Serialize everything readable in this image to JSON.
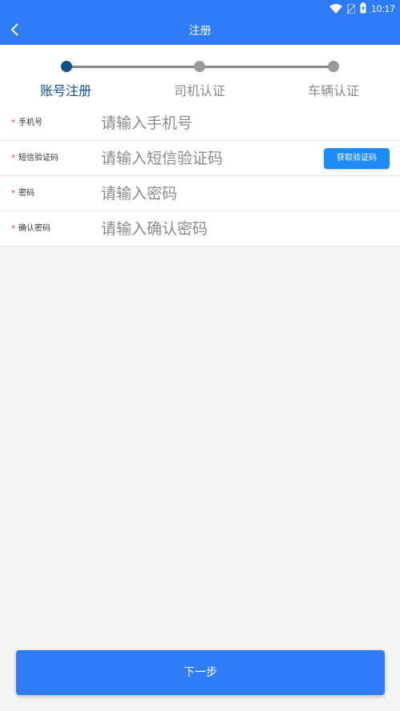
{
  "status_bar": {
    "time": "10:17",
    "icons": [
      "wifi-icon",
      "no-sim-icon",
      "battery-icon"
    ]
  },
  "app_bar": {
    "title": "注册",
    "back_icon": "chevron-left-icon"
  },
  "stepper": {
    "steps": [
      {
        "label": "账号注册",
        "active": true
      },
      {
        "label": "司机认证",
        "active": false
      },
      {
        "label": "车辆认证",
        "active": false
      }
    ]
  },
  "form": {
    "required_mark": "*",
    "fields": [
      {
        "label": "手机号",
        "placeholder": "请输入手机号",
        "value": ""
      },
      {
        "label": "短信验证码",
        "placeholder": "请输入短信验证码",
        "value": ""
      },
      {
        "label": "密码",
        "placeholder": "请输入密码",
        "value": ""
      },
      {
        "label": "确认密码",
        "placeholder": "请输入确认密码",
        "value": ""
      }
    ],
    "get_code_label": "获取验证码"
  },
  "footer": {
    "next_label": "下一步"
  },
  "colors": {
    "primary": "#2d7bf6",
    "step_active": "#0d4f8b",
    "step_inactive": "#9a9a9a",
    "required": "#e53935",
    "code_button": "#1d8cf8"
  }
}
